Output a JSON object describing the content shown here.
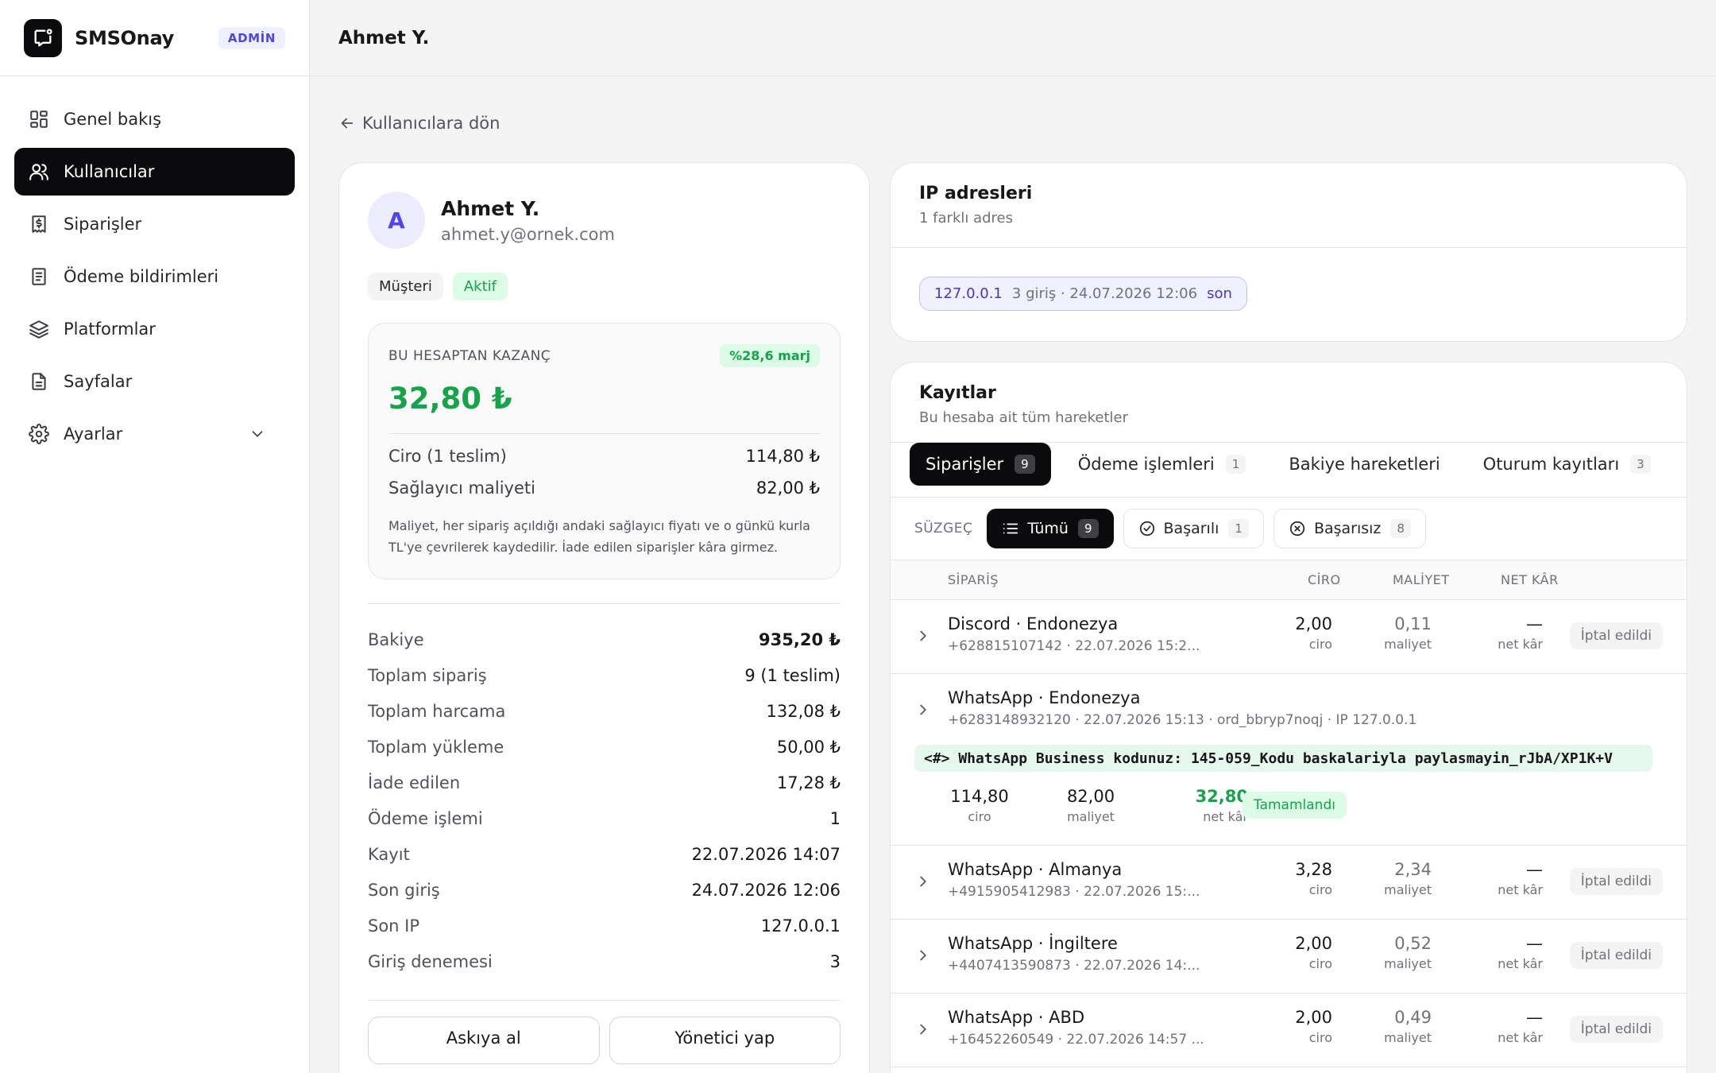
{
  "brand": {
    "name": "SMSOnay",
    "badge": "ADMİN"
  },
  "nav": [
    {
      "label": "Genel bakış",
      "icon": "dashboard-icon"
    },
    {
      "label": "Kullanıcılar",
      "icon": "users-icon",
      "active": true
    },
    {
      "label": "Siparişler",
      "icon": "receipt-icon"
    },
    {
      "label": "Ödeme bildirimleri",
      "icon": "document-icon"
    },
    {
      "label": "Platformlar",
      "icon": "layers-icon"
    },
    {
      "label": "Sayfalar",
      "icon": "file-icon"
    },
    {
      "label": "Ayarlar",
      "icon": "gear-icon"
    }
  ],
  "topbar": {
    "title": "Ahmet Y."
  },
  "back_label": "Kullanıcılara dön",
  "profile": {
    "avatar": "A",
    "name": "Ahmet Y.",
    "email": "ahmet.y@ornek.com",
    "tags": [
      "Müşteri",
      "Aktif"
    ],
    "earnings": {
      "label": "BU HESAPTAN KAZANÇ",
      "margin": "%28,6 marj",
      "value": "32,80 ₺",
      "rows": [
        {
          "label": "Ciro (1 teslim)",
          "value": "114,80 ₺"
        },
        {
          "label": "Sağlayıcı maliyeti",
          "value": "82,00 ₺"
        }
      ],
      "note": "Maliyet, her sipariş açıldığı andaki sağlayıcı fiyatı ve o günkü kurla TL'ye çevrilerek kaydedilir. İade edilen siparişler kâra girmez."
    },
    "stats": [
      {
        "label": "Bakiye",
        "value": "935,20 ₺"
      },
      {
        "label": "Toplam sipariş",
        "value": "9 (1 teslim)"
      },
      {
        "label": "Toplam harcama",
        "value": "132,08 ₺"
      },
      {
        "label": "Toplam yükleme",
        "value": "50,00 ₺"
      },
      {
        "label": "İade edilen",
        "value": "17,28 ₺"
      },
      {
        "label": "Ödeme işlemi",
        "value": "1"
      },
      {
        "label": "Kayıt",
        "value": "22.07.2026 14:07"
      },
      {
        "label": "Son giriş",
        "value": "24.07.2026 12:06"
      },
      {
        "label": "Son IP",
        "value": "127.0.0.1"
      },
      {
        "label": "Giriş denemesi",
        "value": "3"
      }
    ],
    "actions": [
      "Askıya al",
      "Yönetici yap"
    ]
  },
  "ip": {
    "title": "IP adresleri",
    "subtitle": "1 farklı adres",
    "chip": {
      "ip": "127.0.0.1",
      "info": "3 giriş · 24.07.2026 12:06",
      "tag": "son"
    }
  },
  "records": {
    "title": "Kayıtlar",
    "subtitle": "Bu hesaba ait tüm hareketler",
    "tabs": [
      {
        "label": "Siparişler",
        "count": "9"
      },
      {
        "label": "Ödeme işlemleri",
        "count": "1"
      },
      {
        "label": "Bakiye hareketleri",
        "count": ""
      },
      {
        "label": "Oturum kayıtları",
        "count": "3"
      }
    ],
    "filter": {
      "label": "SÜZGEÇ",
      "options": [
        {
          "label": "Tümü",
          "count": "9"
        },
        {
          "label": "Başarılı",
          "count": "1"
        },
        {
          "label": "Başarısız",
          "count": "8"
        }
      ]
    },
    "columns": {
      "order": "SİPARİŞ",
      "revenue": "CİRO",
      "cost": "MALİYET",
      "profit": "NET KÂR"
    },
    "unit_labels": {
      "revenue": "ciro",
      "cost": "maliyet",
      "profit": "net kâr"
    },
    "rows": [
      {
        "title": "Discord · Endonezya",
        "sub": "+628815107142 · 22.07.2026 15:2...",
        "revenue": "2,00",
        "cost": "0,11",
        "profit": "—",
        "status": "İptal edildi"
      },
      {
        "title": "WhatsApp · Endonezya",
        "sub": "+6283148932120 · 22.07.2026 15:13 · ord_bbryp7noqj · IP 127.0.0.1",
        "message": "<#> WhatsApp Business kodunuz: 145-059_Kodu baskalariyla paylasmayin_rJbA/XP1K+V",
        "revenue": "114,80",
        "cost": "82,00",
        "profit": "32,80",
        "status": "Tamamlandı"
      },
      {
        "title": "WhatsApp · Almanya",
        "sub": "+4915905412983 · 22.07.2026 15:...",
        "revenue": "3,28",
        "cost": "2,34",
        "profit": "—",
        "status": "İptal edildi"
      },
      {
        "title": "WhatsApp · İngiltere",
        "sub": "+4407413590873 · 22.07.2026 14:...",
        "revenue": "2,00",
        "cost": "0,52",
        "profit": "—",
        "status": "İptal edildi"
      },
      {
        "title": "WhatsApp · ABD",
        "sub": "+16452260549 · 22.07.2026 14:57 ...",
        "revenue": "2,00",
        "cost": "0,49",
        "profit": "—",
        "status": "İptal edildi"
      }
    ]
  }
}
